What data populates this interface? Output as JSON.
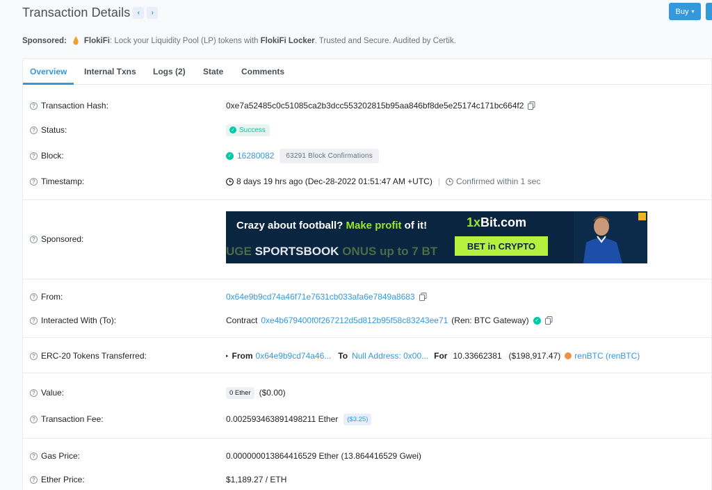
{
  "header": {
    "title": "Transaction Details",
    "prev_icon": "chevron-left-icon",
    "next_icon": "chevron-right-icon",
    "prev_glyph": "‹",
    "next_glyph": "›",
    "buy_label": "Buy",
    "buy_caret": "▾"
  },
  "sponsored_top": {
    "prefix": "Sponsored:",
    "brand": "FlokiFi",
    "text1": ": Lock your Liquidity Pool (LP) tokens with ",
    "link": "FlokiFi Locker",
    "text2": ". Trusted and Secure. Audited by Certik."
  },
  "tabs": [
    {
      "label": "Overview",
      "active": true
    },
    {
      "label": "Internal Txns"
    },
    {
      "label": "Logs (2)"
    },
    {
      "label": "State"
    },
    {
      "label": "Comments"
    }
  ],
  "help_glyph": "?",
  "fields": {
    "tx_hash": {
      "label": "Transaction Hash:",
      "value": "0xe7a52485c0c51085ca2b3dcc553202815b95aa846bf8de5e25174c171bc664f2"
    },
    "status": {
      "label": "Status:",
      "value": "Success",
      "check": "✓"
    },
    "block": {
      "label": "Block:",
      "value": "16280082",
      "confirmations": "63291 Block Confirmations"
    },
    "timestamp": {
      "label": "Timestamp:",
      "value": "8 days 19 hrs ago (Dec-28-2022 01:51:47 AM +UTC)",
      "sep": "|",
      "confirmed": "Confirmed within 1 sec"
    },
    "sponsored": {
      "label": "Sponsored:"
    },
    "from": {
      "label": "From:",
      "value": "0x64e9b9cd74a46f71e7631cb033afa6e7849a8683"
    },
    "to": {
      "label": "Interacted With (To):",
      "prefix": "Contract",
      "value": "0xe4b679400f0f267212d5d812b95f58c83243ee71",
      "name": "(Ren: BTC Gateway)"
    },
    "erc20": {
      "label": "ERC-20 Tokens Transferred:",
      "caret": "▸",
      "from_label": "From",
      "from_value": "0x64e9b9cd74a46...",
      "to_label": "To",
      "to_value": "Null Address: 0x00...",
      "for_label": "For",
      "amount": "10.33662381",
      "usd": "($198,917.47)",
      "token": "renBTC (renBTC)"
    },
    "value": {
      "label": "Value:",
      "badge": "0 Ether",
      "usd": "($0.00)"
    },
    "fee": {
      "label": "Transaction Fee:",
      "value": "0.002593463891498211 Ether",
      "usd": "($3.25)"
    },
    "gas_price": {
      "label": "Gas Price:",
      "value": "0.000000013864416529 Ether (13.864416529 Gwei)"
    },
    "ether_price": {
      "label": "Ether Price:",
      "value": "$1,189.27 / ETH"
    }
  },
  "ad": {
    "headline_a": "Crazy about football? ",
    "headline_b": "Make profit",
    "headline_c": " of it!",
    "scroll_a": "UGE ",
    "scroll_b": "SPORTSBOOK",
    "scroll_c": " ONUS up to 7 BT",
    "logo_a": "1x",
    "logo_b": "Bit.com",
    "cta": "BET in CRYPTO"
  },
  "colors": {
    "accent": "#3498db",
    "success": "#00c9a7",
    "token": "#f09242"
  }
}
